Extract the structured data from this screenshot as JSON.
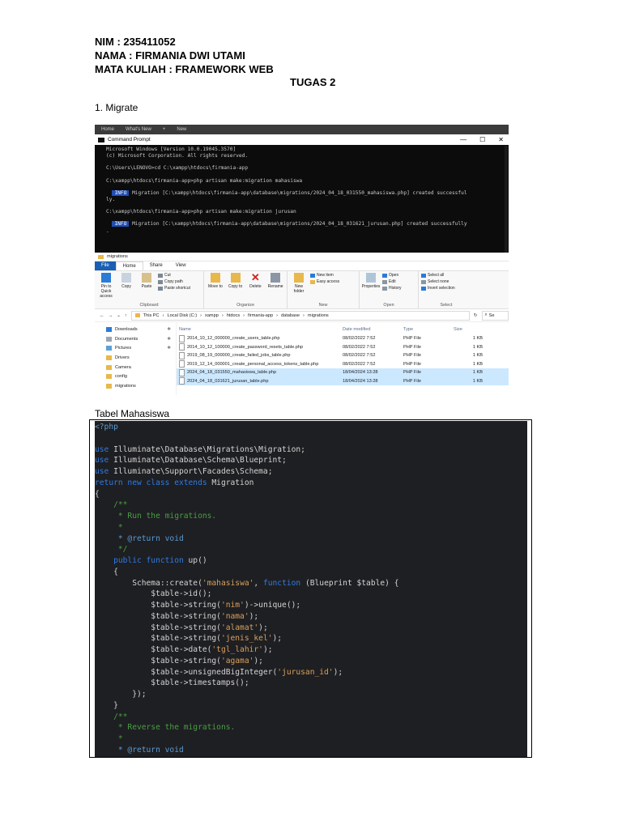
{
  "header": {
    "nim": "NIM : 235411052",
    "nama": "NAMA : FIRMANIA DWI UTAMI",
    "mata_kuliah": "MATA KULIAH : FRAMEWORK WEB",
    "tugas": "TUGAS 2"
  },
  "section1": {
    "title": "1. Migrate"
  },
  "terminal": {
    "tabs": [
      "Home",
      "What's New",
      "+",
      "New"
    ],
    "window_title": "Command Prompt",
    "window_buttons": [
      "—",
      "☐",
      "✕"
    ],
    "line1": "Microsoft Windows [Version 10.0.19045.3570]",
    "line2": "(c) Microsoft Corporation. All rights reserved.",
    "line3": "C:\\Users\\LENOVO>cd C:\\xampp\\htdocs\\firmania-app",
    "line4": "C:\\xampp\\htdocs\\firmania-app>php artisan make:migration mahasiswa",
    "info_tag": "INFO",
    "line5": " Migration [C:\\xampp\\htdocs\\firmania-app\\database\\migrations/2024_04_18_031550_mahasiswa.php] created successful",
    "line5b": "ly.",
    "line6": "C:\\xampp\\htdocs\\firmania-app>php artisan make:migration jurusan",
    "line7": " Migration [C:\\xampp\\htdocs\\firmania-app\\database\\migrations/2024_04_18_031621_jurusan.php] created successfully",
    "line7b": "."
  },
  "explorer": {
    "qat_title": "migrations",
    "menu": [
      "File",
      "Home",
      "Share",
      "View"
    ],
    "clipboard": {
      "pin": "Pin to Quick access",
      "copy": "Copy",
      "paste": "Paste",
      "cut": "Cut",
      "copy_path": "Copy path",
      "paste_shortcut": "Paste shortcut",
      "caption": "Clipboard"
    },
    "organize": {
      "move": "Move to",
      "copy": "Copy to",
      "delete": "Delete",
      "rename": "Rename",
      "caption": "Organize"
    },
    "new": {
      "folder": "New folder",
      "new_item": "New item",
      "easy_access": "Easy access",
      "caption": "New"
    },
    "open": {
      "properties": "Properties",
      "open": "Open",
      "edit": "Edit",
      "history": "History",
      "caption": "Open"
    },
    "select": {
      "all": "Select all",
      "none": "Select none",
      "invert": "Invert selection",
      "caption": "Select"
    },
    "breadcrumb": [
      "This PC",
      "Local Disk (C:)",
      "xampp",
      "htdocs",
      "firmania-app",
      "database",
      "migrations"
    ],
    "search_placeholder": "Se",
    "nav": [
      {
        "label": "Downloads",
        "kind": "blue"
      },
      {
        "label": "Documents",
        "kind": "doc"
      },
      {
        "label": "Pictures",
        "kind": "pic"
      },
      {
        "label": "Drivers",
        "kind": "folder"
      },
      {
        "label": "Camera",
        "kind": "folder"
      },
      {
        "label": "config",
        "kind": "folder"
      },
      {
        "label": "migrations",
        "kind": "folder"
      }
    ],
    "columns": {
      "name": "Name",
      "date": "Date modified",
      "type": "Type",
      "size": "Size"
    },
    "files": [
      {
        "name": "2014_10_12_000000_create_users_table.php",
        "date": "08/02/2022 7:52",
        "type": "PHP File",
        "size": "1 KB",
        "selected": false
      },
      {
        "name": "2014_10_12_100000_create_password_resets_table.php",
        "date": "08/02/2022 7:52",
        "type": "PHP File",
        "size": "1 KB",
        "selected": false
      },
      {
        "name": "2019_08_19_000000_create_failed_jobs_table.php",
        "date": "08/02/2022 7:52",
        "type": "PHP File",
        "size": "1 KB",
        "selected": false
      },
      {
        "name": "2019_12_14_000001_create_personal_access_tokens_table.php",
        "date": "08/02/2022 7:52",
        "type": "PHP File",
        "size": "1 KB",
        "selected": false
      },
      {
        "name": "2024_04_18_031550_mahasiswa_table.php",
        "date": "18/04/2024 13:28",
        "type": "PHP File",
        "size": "1 KB",
        "selected": true
      },
      {
        "name": "2024_04_18_031621_jurusan_table.php",
        "date": "18/04/2024 13:28",
        "type": "PHP File",
        "size": "1 KB",
        "selected": true
      }
    ]
  },
  "section2": {
    "title": "Tabel Mahasiswa"
  },
  "code": {
    "php_open": "<?php",
    "use": "use",
    "migration_ns": " Illuminate\\Database\\Migrations\\Migration;",
    "blueprint_ns": " Illuminate\\Database\\Schema\\Blueprint;",
    "schema_ns": " Illuminate\\Support\\Facades\\Schema;",
    "return_kw": "return new class extends",
    "return_rest": " Migration",
    "open_brace": "{",
    "doc_open": "    /**",
    "run_comment": "     * Run the migrations.",
    "star": "     *",
    "return_tag": "     * @return void",
    "doc_close": "     */",
    "public_fn": "    public function",
    "up": " up()",
    "indent_brace": "    {",
    "schema_create": "        Schema::create(",
    "table_mahasiswa": "'mahasiswa'",
    "comma": ", ",
    "function_kw": "function",
    "closure_args": " (Blueprint $table) {",
    "id_line": "            $table->id();",
    "string_call": "            $table->string(",
    "f_nim": "'nim'",
    "unique_tail": ")->unique();",
    "end_call": ");",
    "f_nama": "'nama'",
    "f_alamat": "'alamat'",
    "f_jenis_kel": "'jenis_kel'",
    "date_call": "            $table->date(",
    "f_tgl_lahir": "'tgl_lahir'",
    "f_agama": "'agama'",
    "ubi_call": "            $table->unsignedBigInteger(",
    "f_jurusan_id": "'jurusan_id'",
    "timestamps_line": "            $table->timestamps();",
    "closure_close": "        });",
    "method_close": "    }",
    "reverse_comment": "     * Reverse the migrations."
  }
}
